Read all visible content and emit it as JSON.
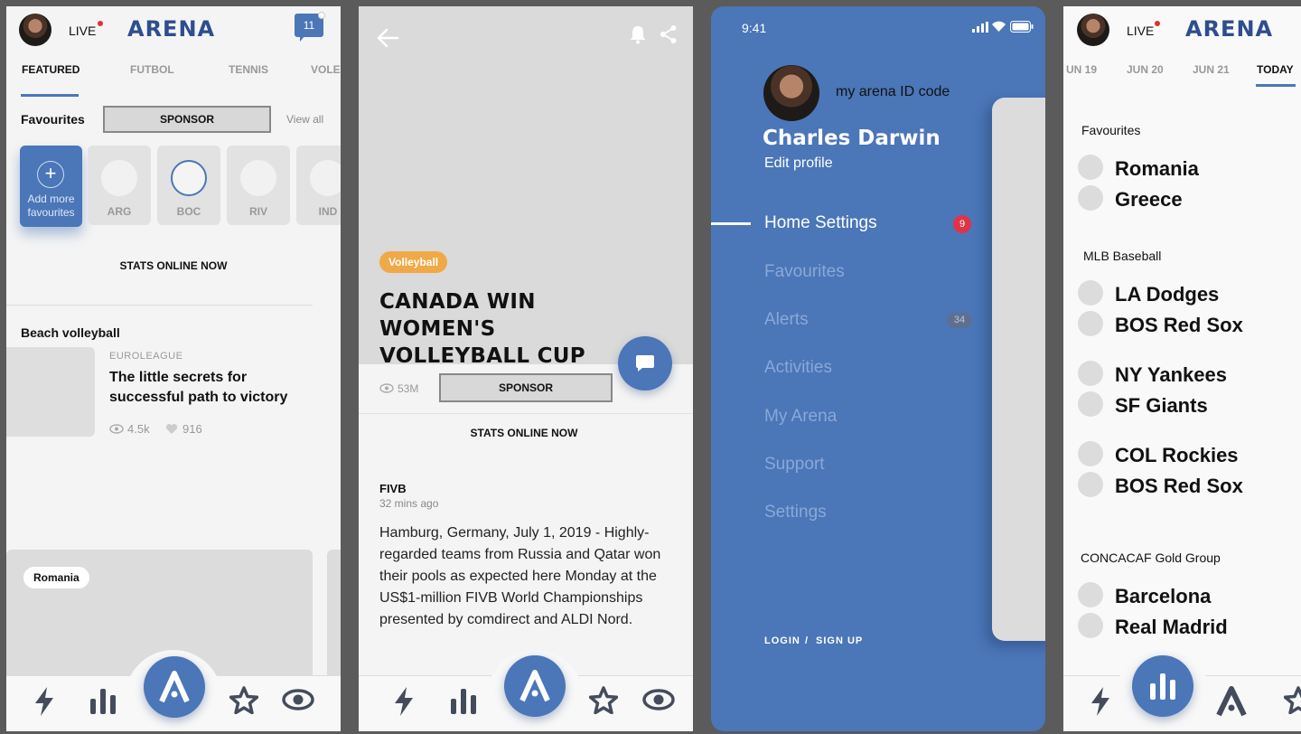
{
  "screen1": {
    "live_label": "LIVE",
    "logo": "ARENA",
    "chat_count": "11",
    "tabs": [
      "FEATURED",
      "FUTBOL",
      "TENNIS",
      "VOLE"
    ],
    "favourites_title": "Favourites",
    "sponsor": "SPONSOR",
    "view_all": "View all",
    "add_more": "Add more favourites",
    "teams": [
      "ARG",
      "BOC",
      "RIV",
      "IND"
    ],
    "stats_online": "STATS ONLINE NOW",
    "section": "Beach volleyball",
    "article": {
      "category": "EUROLEAGUE",
      "title": "The  little secrets for successful path to victory",
      "views": "4.5k",
      "likes": "916"
    },
    "card_tag": "Romania"
  },
  "screen2": {
    "tag": "Volleyball",
    "headline": "CANADA WIN WOMEN'S VOLLEYBALL CUP",
    "views": "53M",
    "sponsor": "SPONSOR",
    "stats_online": "STATS ONLINE NOW",
    "source": "FIVB",
    "time": "32 mins ago",
    "body": "Hamburg, Germany, July 1, 2019 - Highly-regarded teams from Russia and Qatar won their pools as expected here Monday at the US$1-million FIVB World Championships presented by comdirect and ALDI Nord."
  },
  "screen3": {
    "time": "9:41",
    "id_code": "my arena ID code",
    "name": "Charles Darwin",
    "edit_profile": "Edit profile",
    "menu": [
      {
        "label": "Home Settings",
        "badge": "9"
      },
      {
        "label": "Favourites",
        "badge": ""
      },
      {
        "label": "Alerts",
        "badge": "34"
      },
      {
        "label": "Activities",
        "badge": ""
      },
      {
        "label": "My Arena",
        "badge": ""
      },
      {
        "label": "Support",
        "badge": ""
      },
      {
        "label": "Settings",
        "badge": ""
      }
    ],
    "login": "LOGIN",
    "separator": "/",
    "signup": "SIGN UP"
  },
  "screen4": {
    "live_label": "LIVE",
    "logo": "ARENA",
    "dates": [
      "UN 19",
      "JUN 20",
      "JUN 21",
      "TODAY"
    ],
    "groups": [
      {
        "title": "Favourites",
        "teams": [
          "Romania",
          "Greece"
        ]
      },
      {
        "title": "MLB Baseball",
        "teams": [
          "LA Dodges",
          "BOS Red Sox",
          "NY Yankees",
          "SF Giants",
          "COL Rockies",
          "BOS Red Sox"
        ]
      },
      {
        "title": "CONCACAF Gold Group",
        "teams": [
          "Barcelona",
          "Real Madrid"
        ]
      }
    ]
  },
  "colors": {
    "brand": "#4b76b8",
    "logo": "#2f4d8f",
    "tag": "#f0a947",
    "badge": "#e0334a"
  }
}
